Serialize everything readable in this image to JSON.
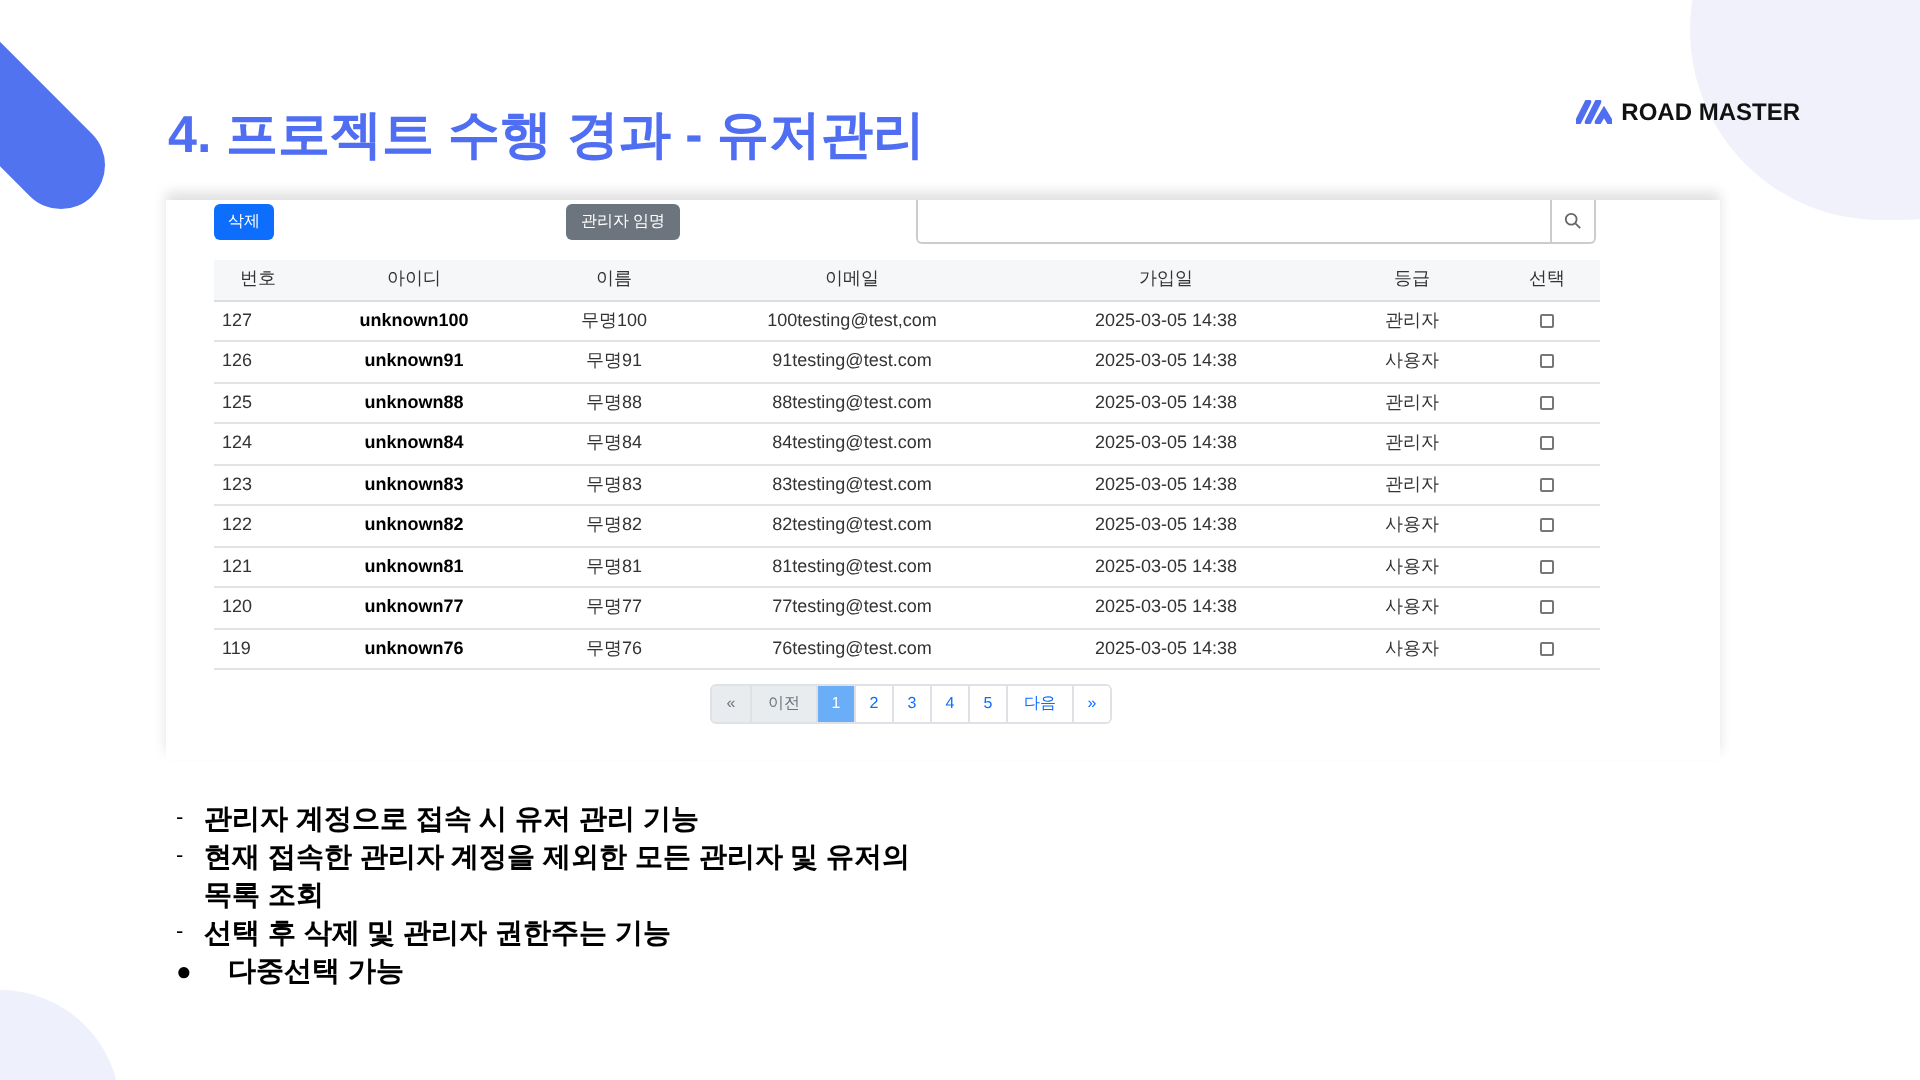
{
  "title": "4. 프로젝트 수행 경과 - 유저관리",
  "logo": {
    "text": "ROAD MASTER"
  },
  "toolbar": {
    "delete_button": "삭제",
    "promote_button": "관리자 임명"
  },
  "table": {
    "columns": [
      "번호",
      "아이디",
      "이름",
      "이메일",
      "가입일",
      "등급",
      "선택"
    ],
    "rows": [
      {
        "cells": [
          "127",
          "unknown100",
          "무명100",
          "100testing@test,com",
          "2025-03-05 14:38",
          "관리자"
        ],
        "checked": false
      },
      {
        "cells": [
          "126",
          "unknown91",
          "무명91",
          "91testing@test.com",
          "2025-03-05 14:38",
          "사용자"
        ],
        "checked": false
      },
      {
        "cells": [
          "125",
          "unknown88",
          "무명88",
          "88testing@test.com",
          "2025-03-05 14:38",
          "관리자"
        ],
        "checked": false
      },
      {
        "cells": [
          "124",
          "unknown84",
          "무명84",
          "84testing@test.com",
          "2025-03-05 14:38",
          "관리자"
        ],
        "checked": false
      },
      {
        "cells": [
          "123",
          "unknown83",
          "무명83",
          "83testing@test.com",
          "2025-03-05 14:38",
          "관리자"
        ],
        "checked": false
      },
      {
        "cells": [
          "122",
          "unknown82",
          "무명82",
          "82testing@test.com",
          "2025-03-05 14:38",
          "사용자"
        ],
        "checked": false
      },
      {
        "cells": [
          "121",
          "unknown81",
          "무명81",
          "81testing@test.com",
          "2025-03-05 14:38",
          "사용자"
        ],
        "checked": false
      },
      {
        "cells": [
          "120",
          "unknown77",
          "무명77",
          "77testing@test.com",
          "2025-03-05 14:38",
          "사용자"
        ],
        "checked": false
      },
      {
        "cells": [
          "119",
          "unknown76",
          "무명76",
          "76testing@test.com",
          "2025-03-05 14:38",
          "사용자"
        ],
        "checked": false
      }
    ]
  },
  "pagination": [
    {
      "label": "«",
      "selected": false,
      "disabled": true
    },
    {
      "label": "이전",
      "selected": false,
      "disabled": true
    },
    {
      "label": "1",
      "selected": true,
      "disabled": false
    },
    {
      "label": "2",
      "selected": false,
      "disabled": false
    },
    {
      "label": "3",
      "selected": false,
      "disabled": false
    },
    {
      "label": "4",
      "selected": false,
      "disabled": false
    },
    {
      "label": "5",
      "selected": false,
      "disabled": false
    },
    {
      "label": "다음",
      "selected": false,
      "disabled": false
    },
    {
      "label": "»",
      "selected": false,
      "disabled": false
    }
  ],
  "bullets": [
    {
      "marker": "-",
      "text": "관리자 계정으로 접속 시 유저 관리 기능"
    },
    {
      "marker": "-",
      "text": "현재 접속한 관리자 계정을 제외한 모든 관리자 및 유저의 목록 조회"
    },
    {
      "marker": "-",
      "text": "선택 후 삭제 및 관리자 권한주는 기능"
    },
    {
      "marker": "●",
      "text": "다중선택 가능"
    }
  ]
}
